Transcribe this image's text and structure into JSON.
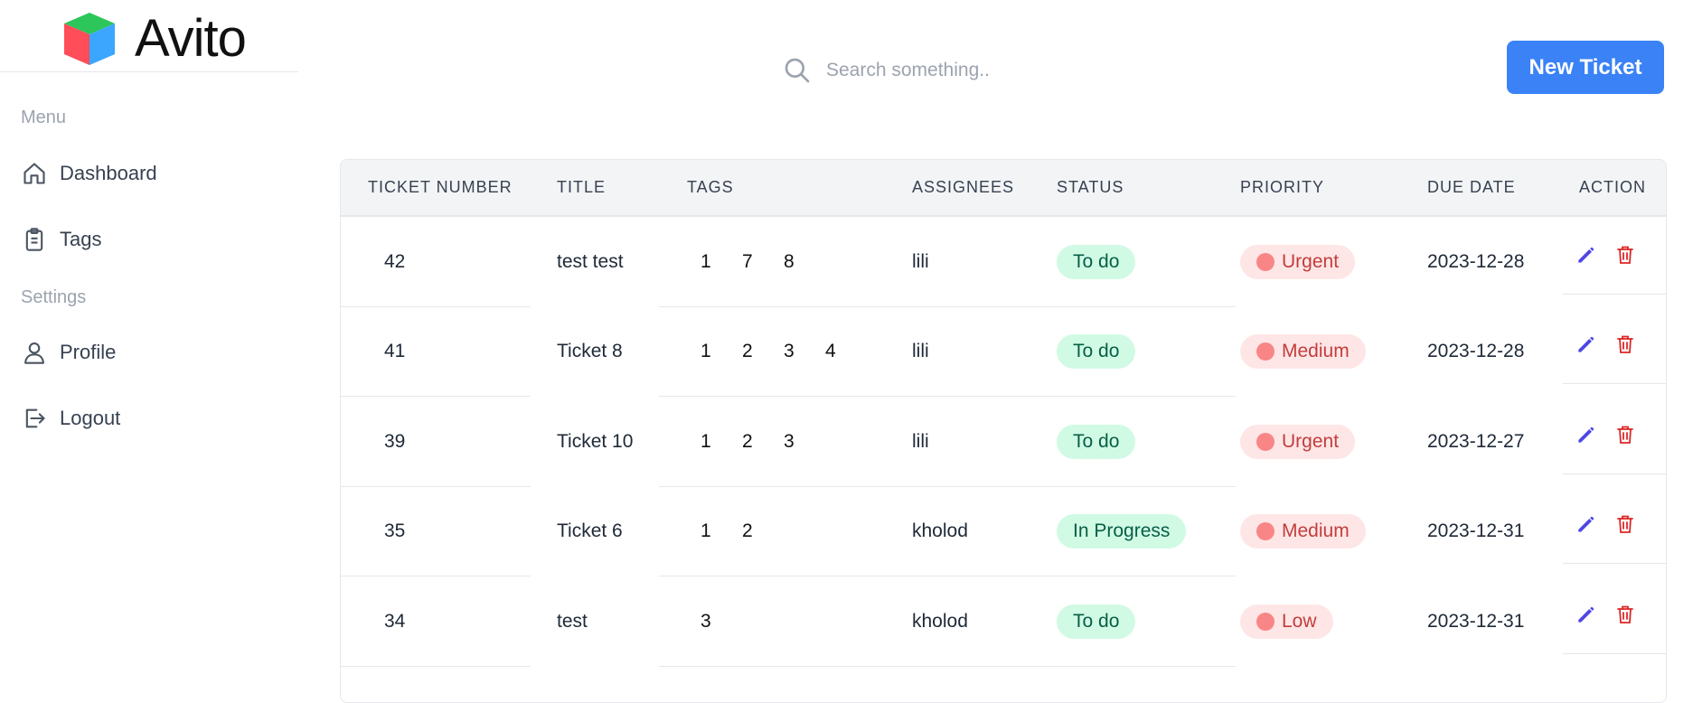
{
  "brand": {
    "name": "Avito"
  },
  "sidebar": {
    "menu_label": "Menu",
    "settings_label": "Settings",
    "items": [
      {
        "label": "Dashboard",
        "icon": "home-icon"
      },
      {
        "label": "Tags",
        "icon": "clipboard-icon"
      },
      {
        "label": "Profile",
        "icon": "user-icon"
      },
      {
        "label": "Logout",
        "icon": "logout-icon"
      }
    ]
  },
  "search": {
    "placeholder": "Search something..",
    "value": ""
  },
  "header": {
    "new_ticket_label": "New Ticket"
  },
  "table": {
    "columns": [
      "TICKET NUMBER",
      "TITLE",
      "TAGS",
      "ASSIGNEES",
      "STATUS",
      "PRIORITY",
      "DUE DATE",
      "ACTION"
    ],
    "rows": [
      {
        "number": "42",
        "title": "test test",
        "tags": [
          "1",
          "7",
          "8"
        ],
        "assignee": "lili",
        "status": "To do",
        "priority": "Urgent",
        "due": "2023-12-28"
      },
      {
        "number": "41",
        "title": "Ticket 8",
        "tags": [
          "1",
          "2",
          "3",
          "4"
        ],
        "assignee": "lili",
        "status": "To do",
        "priority": "Medium",
        "due": "2023-12-28"
      },
      {
        "number": "39",
        "title": "Ticket 10",
        "tags": [
          "1",
          "2",
          "3"
        ],
        "assignee": "lili",
        "status": "To do",
        "priority": "Urgent",
        "due": "2023-12-27"
      },
      {
        "number": "35",
        "title": "Ticket 6",
        "tags": [
          "1",
          "2"
        ],
        "assignee": "kholod",
        "status": "In Progress",
        "priority": "Medium",
        "due": "2023-12-31"
      },
      {
        "number": "34",
        "title": "test",
        "tags": [
          "3"
        ],
        "assignee": "kholod",
        "status": "To do",
        "priority": "Low",
        "due": "2023-12-31"
      }
    ]
  },
  "colors": {
    "accent": "#3b82f6",
    "status_bg": "#d1fae5",
    "status_text": "#065f46",
    "priority_bg": "#fee2e2",
    "priority_text": "#b91c1c",
    "edit_icon": "#4f46e5",
    "delete_icon": "#dc2626"
  }
}
